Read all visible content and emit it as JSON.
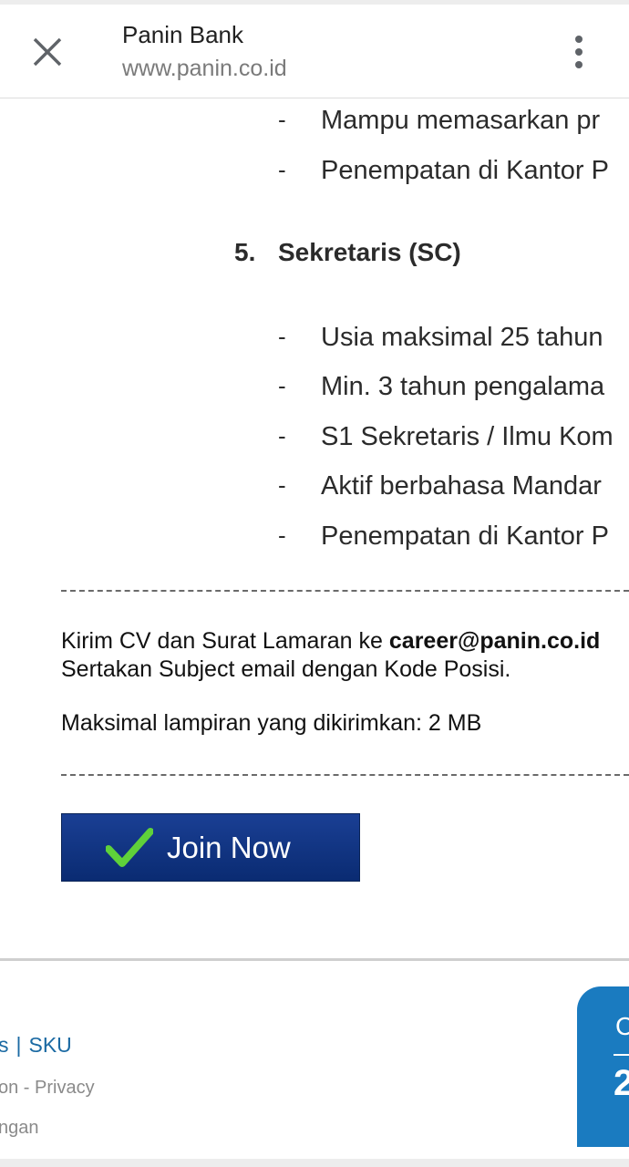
{
  "header": {
    "title": "Panin Bank",
    "url": "www.panin.co.id"
  },
  "document_scan": {
    "top_items": [
      "Mampu memasarkan pr",
      "Penempatan di Kantor P"
    ],
    "section": {
      "number": "5.",
      "title": "Sekretaris (SC)",
      "items": [
        "Usia maksimal 25 tahun",
        "Min. 3 tahun pengalama",
        "S1 Sekretaris / Ilmu Kom",
        "Aktif berbahasa Mandar",
        "Penempatan di Kantor P"
      ]
    }
  },
  "content": {
    "send_cv_prefix": "Kirim CV dan Surat Lamaran ke ",
    "email": "career@panin.co.id",
    "subject_note": "Sertakan Subject email dengan Kode Posisi.",
    "attachment_note": "Maksimal lampiran yang dikirimkan: 2 MB",
    "join_button": "Join Now"
  },
  "footer": {
    "link_partial": "s",
    "link_sku": "SKU",
    "line1": "on - Privacy",
    "line2": "ngan",
    "card_letter": "C",
    "card_number": "2"
  },
  "colors": {
    "join_button_bg": "#0f3380",
    "link": "#1b6aa3",
    "card_bg": "#1a7bc0"
  }
}
